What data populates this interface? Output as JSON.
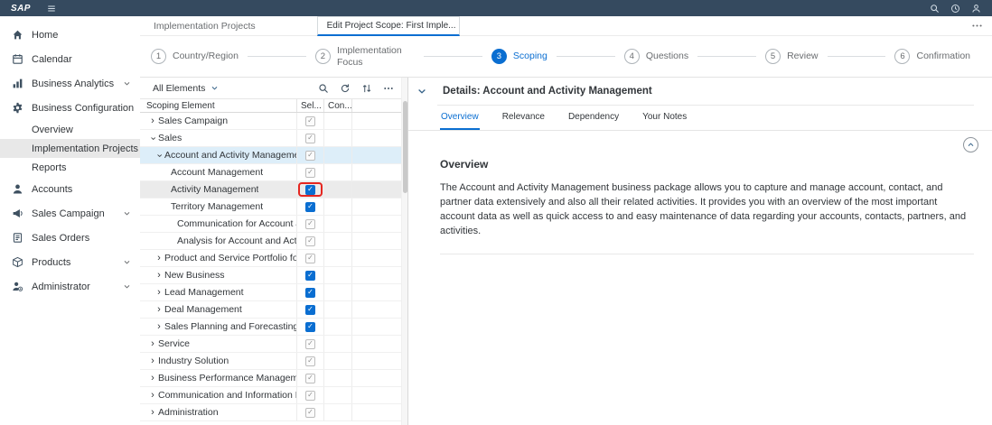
{
  "colors": {
    "accent": "#0a6ed1",
    "shell_bar": "#354a5f",
    "annotation_red": "#e52620",
    "row_highlight_blue": "#ddeef9",
    "row_highlight_gray": "#ebebeb"
  },
  "glyphs": {
    "check": "✓",
    "expander": "›"
  },
  "shell": {
    "logo": "SAP"
  },
  "tabstrip": {
    "tabs": [
      {
        "label": "Implementation Projects",
        "active": false,
        "closable": false
      },
      {
        "label": "Edit Project Scope: First Imple...",
        "active": true,
        "closable": true
      }
    ]
  },
  "sidebar": {
    "items": [
      {
        "label": "Home",
        "icon": "home-icon"
      },
      {
        "label": "Calendar",
        "icon": "calendar-icon"
      },
      {
        "label": "Business Analytics",
        "icon": "analytics-icon",
        "chevron": "down"
      },
      {
        "label": "Business Configuration",
        "icon": "gear-icon",
        "chevron": "up",
        "children": [
          "Overview",
          "Implementation Projects",
          "Reports"
        ],
        "selected_child": "Implementation Projects"
      },
      {
        "label": "Accounts",
        "icon": "person-icon"
      },
      {
        "label": "Sales Campaign",
        "icon": "megaphone-icon",
        "chevron": "down"
      },
      {
        "label": "Sales Orders",
        "icon": "order-icon"
      },
      {
        "label": "Products",
        "icon": "box-icon",
        "chevron": "down"
      },
      {
        "label": "Administrator",
        "icon": "admin-icon",
        "chevron": "down"
      }
    ]
  },
  "wizard": {
    "steps": [
      {
        "num": "1",
        "label": "Country/Region",
        "active": false
      },
      {
        "num": "2",
        "label": "Implementation Focus",
        "active": false
      },
      {
        "num": "3",
        "label": "Scoping",
        "active": true
      },
      {
        "num": "4",
        "label": "Questions",
        "active": false
      },
      {
        "num": "5",
        "label": "Review",
        "active": false
      },
      {
        "num": "6",
        "label": "Confirmation",
        "active": false
      }
    ]
  },
  "scoping": {
    "filter": {
      "label": "All Elements"
    },
    "columns": [
      "Scoping Element",
      "Sel...",
      "Con..."
    ],
    "rows": [
      {
        "label": "Sales Campaign",
        "level": 0,
        "expander": "collapsed",
        "check": "dim",
        "highlight": null,
        "annotated": false
      },
      {
        "label": "Sales",
        "level": 0,
        "expander": "expanded",
        "check": "dim",
        "highlight": null,
        "annotated": false
      },
      {
        "label": "Account and Activity Management",
        "level": 1,
        "expander": "expanded",
        "check": "dim",
        "highlight": "blue",
        "annotated": false
      },
      {
        "label": "Account Management",
        "level": 2,
        "expander": null,
        "check": "dim",
        "highlight": null,
        "annotated": false
      },
      {
        "label": "Activity Management",
        "level": 2,
        "expander": null,
        "check": "blue",
        "highlight": "gray",
        "annotated": true
      },
      {
        "label": "Territory Management",
        "level": 2,
        "expander": null,
        "check": "blue",
        "highlight": null,
        "annotated": false
      },
      {
        "label": "Communication for Account and Ac...",
        "level": 3,
        "expander": null,
        "check": "dim",
        "highlight": null,
        "annotated": false
      },
      {
        "label": "Analysis for Account and Activity M...",
        "level": 3,
        "expander": null,
        "check": "dim",
        "highlight": null,
        "annotated": false
      },
      {
        "label": "Product and Service Portfolio for Sales",
        "level": 1,
        "expander": "collapsed",
        "check": "dim",
        "highlight": null,
        "annotated": false
      },
      {
        "label": "New Business",
        "level": 1,
        "expander": "collapsed",
        "check": "blue",
        "highlight": null,
        "annotated": false
      },
      {
        "label": "Lead Management",
        "level": 1,
        "expander": "collapsed",
        "check": "blue",
        "highlight": null,
        "annotated": false
      },
      {
        "label": "Deal Management",
        "level": 1,
        "expander": "collapsed",
        "check": "blue",
        "highlight": null,
        "annotated": false
      },
      {
        "label": "Sales Planning and Forecasting",
        "level": 1,
        "expander": "collapsed",
        "check": "blue",
        "highlight": null,
        "annotated": false
      },
      {
        "label": "Service",
        "level": 0,
        "expander": "collapsed",
        "check": "dim",
        "highlight": null,
        "annotated": false
      },
      {
        "label": "Industry Solution",
        "level": 0,
        "expander": "collapsed",
        "check": "dim",
        "highlight": null,
        "annotated": false
      },
      {
        "label": "Business Performance Management",
        "level": 0,
        "expander": "collapsed",
        "check": "dim",
        "highlight": null,
        "annotated": false
      },
      {
        "label": "Communication and Information Excha...",
        "level": 0,
        "expander": "collapsed",
        "check": "dim",
        "highlight": null,
        "annotated": false
      },
      {
        "label": "Administration",
        "level": 0,
        "expander": "collapsed",
        "check": "dim",
        "highlight": null,
        "annotated": false
      }
    ]
  },
  "details": {
    "title": "Details: Account and Activity Management",
    "tabs": [
      "Overview",
      "Relevance",
      "Dependency",
      "Your Notes"
    ],
    "active_tab": "Overview",
    "section_title": "Overview",
    "body": "The Account and Activity Management business package allows you to capture and manage account, contact, and partner data extensively and also all their related activities. It provides you with an overview of the most important account data as well as quick access to and easy maintenance of data regarding your accounts, contacts, partners, and activities."
  }
}
